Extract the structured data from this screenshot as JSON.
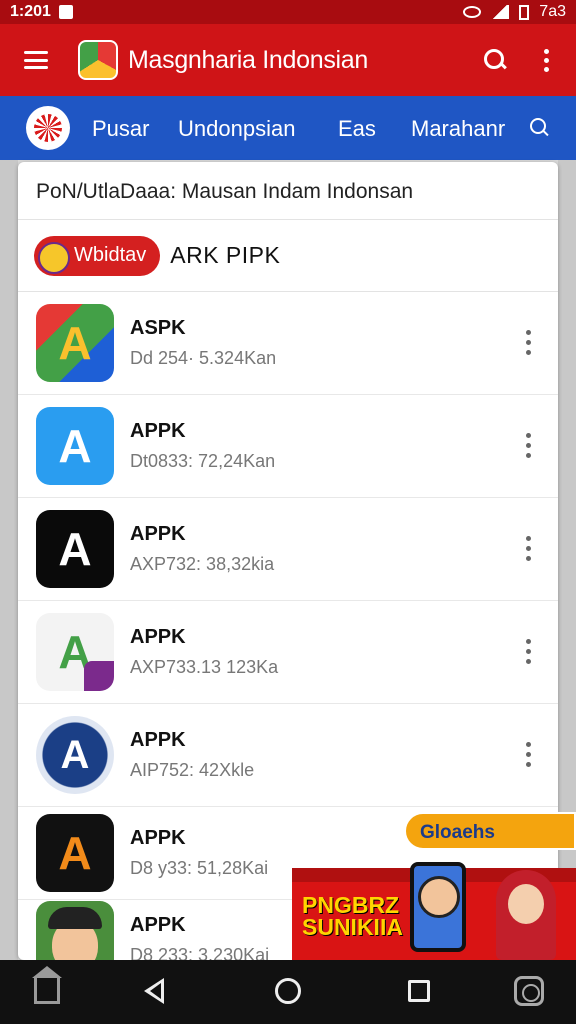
{
  "status_bar": {
    "time": "1:201",
    "battery_text": "7a3"
  },
  "app_bar": {
    "title": "Masgnharia Indonsian"
  },
  "nav": {
    "tabs": [
      "Pusar",
      "Undonpsian",
      "Eas",
      "Marahanr"
    ]
  },
  "dialog": {
    "header": "PoN/UtlaDaaa: Mausan Indam Indonsan",
    "brand_pill": "Wbidtav",
    "brand_title": "ARK PIPK"
  },
  "apps": [
    {
      "name": "ASPK",
      "meta": "Dd 254· 5.324Kan",
      "icon": "apk-multicolor-icon"
    },
    {
      "name": "APPK",
      "meta": "Dt0833: 72,24Kan",
      "icon": "apk-blue-icon"
    },
    {
      "name": "APPK",
      "meta": "AXP732: 38,32kia",
      "icon": "apk-black-icon"
    },
    {
      "name": "APPK",
      "meta": "AXP733.13 123Ka",
      "icon": "apk-green-purple-icon"
    },
    {
      "name": "APPK",
      "meta": "AIP752: 42Xkle",
      "icon": "apk-round-blue-icon"
    },
    {
      "name": "APPK",
      "meta": "D8 y33: 51,28Kai",
      "icon": "apk-orange-icon"
    },
    {
      "name": "APPK",
      "meta": "D8 233: 3.230Kai",
      "icon": "apk-avatar-icon"
    }
  ],
  "promo": {
    "badge": "Gloaehs",
    "banner_title": "PNGBRZ SUNIKIIA"
  },
  "colors": {
    "app_bar": "#cf1417",
    "nav_bar": "#1f56c4",
    "status_bar": "#a80c10"
  }
}
